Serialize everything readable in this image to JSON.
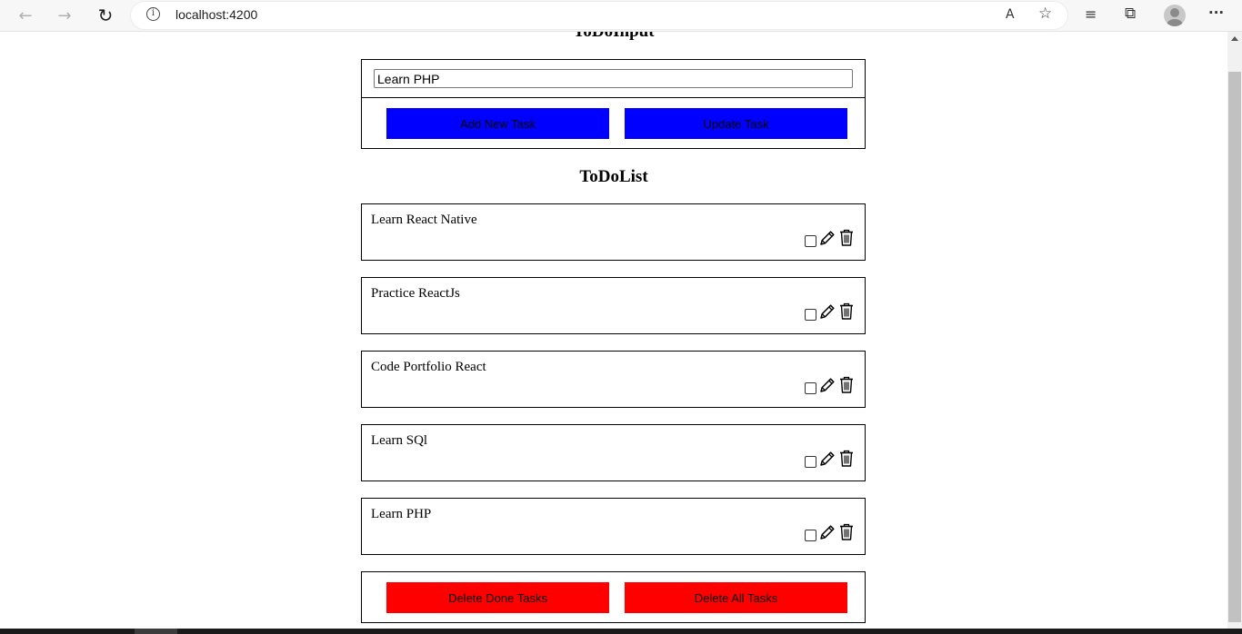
{
  "browser": {
    "url": "localhost:4200",
    "back_icon": "←",
    "forward_icon": "→",
    "reload_icon": "↻",
    "info_icon": "i",
    "read_aloud_icon": "A",
    "favorite_add_icon": "☆",
    "favorites_icon": "≡",
    "collections_icon": "⧉",
    "more_icon": "···"
  },
  "todo_input": {
    "title": "ToDoInput",
    "input_value": "Learn PHP",
    "add_button_label": "Add New Task",
    "update_button_label": "Update Task",
    "button_color": "#0000ff"
  },
  "todo_list": {
    "title": "ToDoList",
    "tasks": [
      {
        "text": "Learn React Native",
        "done": false
      },
      {
        "text": "Practice ReactJs",
        "done": false
      },
      {
        "text": "Code Portfolio React",
        "done": false
      },
      {
        "text": "Learn SQl",
        "done": false
      },
      {
        "text": "Learn PHP",
        "done": false
      }
    ],
    "delete_done_label": "Delete Done Tasks",
    "delete_all_label": "Delete All Tasks",
    "danger_color": "#ff0000"
  }
}
